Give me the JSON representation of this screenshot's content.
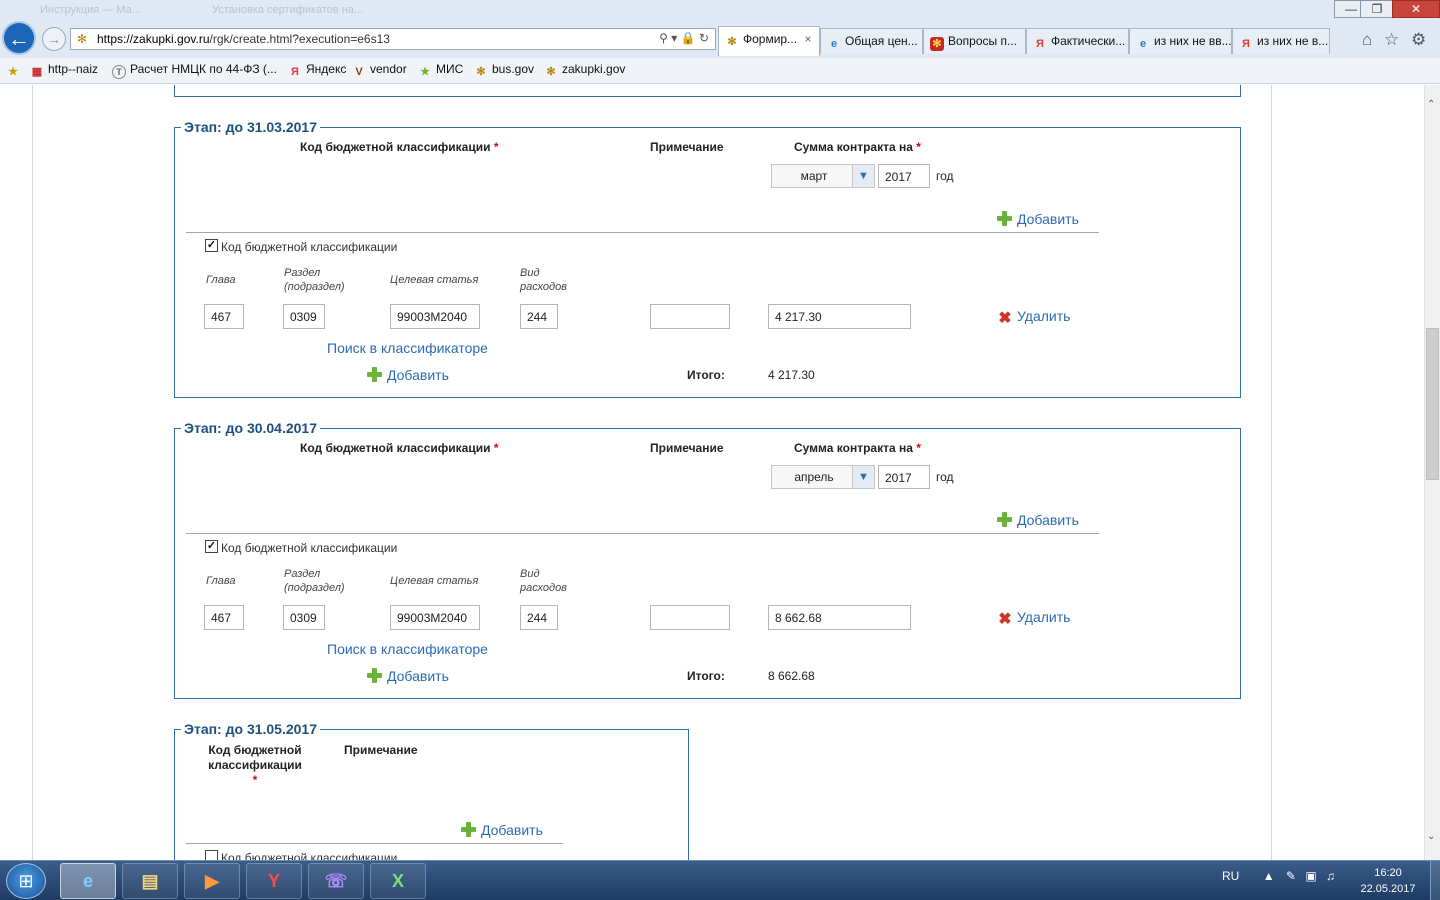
{
  "browser": {
    "ghost_tabs": [
      "Инструкция — Ма...",
      "Установка сертификатов на..."
    ],
    "window_controls": [
      "—",
      "❐",
      "✕"
    ],
    "address": {
      "host": "https://zakupki.gov.ru",
      "path": "/rgk/create.html?execution=e6s13"
    },
    "tabs": [
      {
        "label": "Формир...",
        "close": "×",
        "icon_color": "#b8860b"
      },
      {
        "label": "Общая цен...",
        "icon_color": "#2a7bd0"
      },
      {
        "label": "Вопросы п...",
        "icon_color": "#c62828"
      },
      {
        "label": "Фактически...",
        "icon_color": "#e53935"
      },
      {
        "label": "из них не вв...",
        "icon_color": "#2a7bd0"
      },
      {
        "label": "из них не в...",
        "icon_color": "#e53935"
      }
    ],
    "favorites": [
      {
        "label": "http--naiz",
        "icon": "doc-icon"
      },
      {
        "label": "Расчет НМЦК по 44-ФЗ (...",
        "icon": "t-icon"
      },
      {
        "label": "Яндекс",
        "icon": "yandex-icon"
      },
      {
        "label": "vendor",
        "icon": "v-icon"
      },
      {
        "label": "МИС",
        "icon": "mis-icon"
      },
      {
        "label": "bus.gov",
        "icon": "emblem-icon"
      },
      {
        "label": "zakupki.gov",
        "icon": "emblem-icon"
      }
    ]
  },
  "labels": {
    "kbk_header": "Код бюджетной классификации",
    "kbk_header_wrapped": "Код бюджетной классификации",
    "note_header": "Примечание",
    "sum_header": "Сумма контракта на",
    "required_mark": "*",
    "year_suffix": "год",
    "add": "Добавить",
    "delete": "Удалить",
    "search_classifier": "Поиск в классификаторе",
    "total": "Итого:",
    "kbk_checkbox": "Код бюджетной классификации",
    "col_chapter": "Глава",
    "col_section": "Раздел (подраздел)",
    "col_target": "Целевая статья",
    "col_expense": "Вид расходов"
  },
  "stages": [
    {
      "legend": "Этап: до 31.03.2017",
      "month": "март",
      "year": "2017",
      "checked": "✓",
      "chapter": "467",
      "section": "0309",
      "target": "99003M2040",
      "expense": "244",
      "note": "",
      "amount": "4 217.30",
      "total": "4 217.30"
    },
    {
      "legend": "Этап: до 30.04.2017",
      "month": "апрель",
      "year": "2017",
      "checked": "✓",
      "chapter": "467",
      "section": "0309",
      "target": "99003M2040",
      "expense": "244",
      "note": "",
      "amount": "8 662.68",
      "total": "8 662.68"
    },
    {
      "legend": "Этап: до 31.05.2017",
      "checked": ""
    }
  ],
  "taskbar": {
    "start": "⊞",
    "apps": [
      "e",
      "▤",
      "▶",
      "Y",
      "☏",
      "X"
    ],
    "lang": "RU",
    "time": "16:20",
    "date": "22.05.2017"
  }
}
